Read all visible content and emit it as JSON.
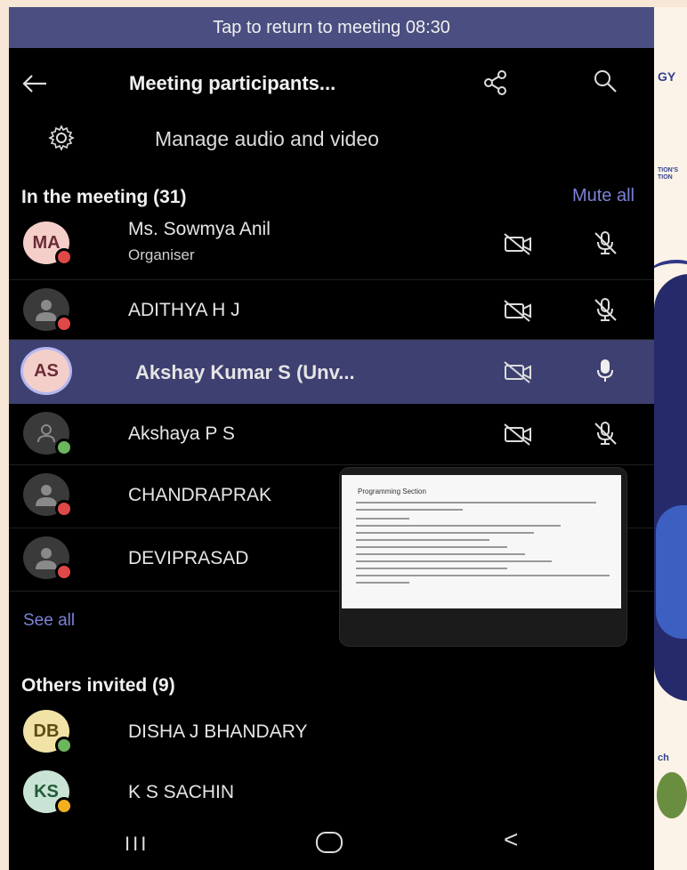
{
  "banner": {
    "text": "Tap to return to meeting 08:30"
  },
  "header": {
    "title": "Meeting participants..."
  },
  "manage": {
    "label": "Manage audio and video"
  },
  "in_meeting": {
    "heading": "In the meeting (31)",
    "mute_all": "Mute all",
    "participants": [
      {
        "initials": "MA",
        "name": "Ms. Sowmya Anil",
        "role": "Organiser",
        "status": "red",
        "mic": "muted"
      },
      {
        "initials": "",
        "name": "ADITHYA H J",
        "status": "red",
        "mic": "muted"
      },
      {
        "initials": "AS",
        "name": "Akshay Kumar S (Unv...",
        "status": "",
        "mic": "on"
      },
      {
        "initials": "",
        "name": "Akshaya P S",
        "status": "green",
        "mic": "muted"
      },
      {
        "initials": "",
        "name": "CHANDRAPRAK",
        "status": "red"
      },
      {
        "initials": "",
        "name": "DEVIPRASAD",
        "status": "red"
      }
    ],
    "see_all": "See all"
  },
  "others": {
    "heading": "Others invited (9)",
    "people": [
      {
        "initials": "DB",
        "name": "DISHA J BHANDARY",
        "status": "green"
      },
      {
        "initials": "KS",
        "name": "K S SACHIN",
        "status": "yellow"
      }
    ]
  },
  "preview": {
    "slide_title": "Programming Section"
  },
  "nav": {
    "recent": "III",
    "back": "<"
  },
  "side": {
    "text1": "GY",
    "text2": "TION'S",
    "text3": "TION",
    "text4": "ch"
  },
  "colors": {
    "banner": "#4a4e80",
    "highlight": "#3e4071",
    "accent": "#7b82d6"
  }
}
